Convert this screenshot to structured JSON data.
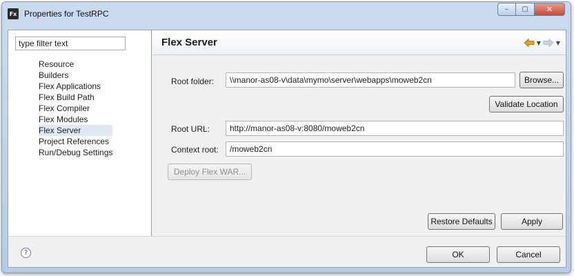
{
  "window": {
    "app_icon": "Fx",
    "title": "Properties for TestRPC",
    "controls": {
      "minimize": "–",
      "maximize": "▢",
      "close": "✕"
    }
  },
  "sidebar": {
    "filter_placeholder": "type filter text",
    "items": [
      {
        "label": "Resource",
        "selected": false
      },
      {
        "label": "Builders",
        "selected": false
      },
      {
        "label": "Flex Applications",
        "selected": false
      },
      {
        "label": "Flex Build Path",
        "selected": false
      },
      {
        "label": "Flex Compiler",
        "selected": false
      },
      {
        "label": "Flex Modules",
        "selected": false
      },
      {
        "label": "Flex Server",
        "selected": true
      },
      {
        "label": "Project References",
        "selected": false
      },
      {
        "label": "Run/Debug Settings",
        "selected": false
      }
    ]
  },
  "page": {
    "title": "Flex Server",
    "root_folder_label": "Root folder:",
    "root_folder_value": "\\\\manor-as08-v\\data\\mymo\\server\\webapps\\moweb2cn",
    "browse_label": "Browse...",
    "validate_label": "Validate Location",
    "root_url_label": "Root URL:",
    "root_url_value": "http://manor-as08-v:8080/moweb2cn",
    "context_root_label": "Context root:",
    "context_root_value": "/moweb2cn",
    "deploy_label": "Deploy Flex WAR...",
    "restore_defaults_label": "Restore Defaults",
    "apply_label": "Apply"
  },
  "footer": {
    "help_icon": "?",
    "ok_label": "OK",
    "cancel_label": "Cancel"
  },
  "colors": {
    "back_arrow": "#e8a317",
    "forward_arrow": "#c9d3dd"
  }
}
